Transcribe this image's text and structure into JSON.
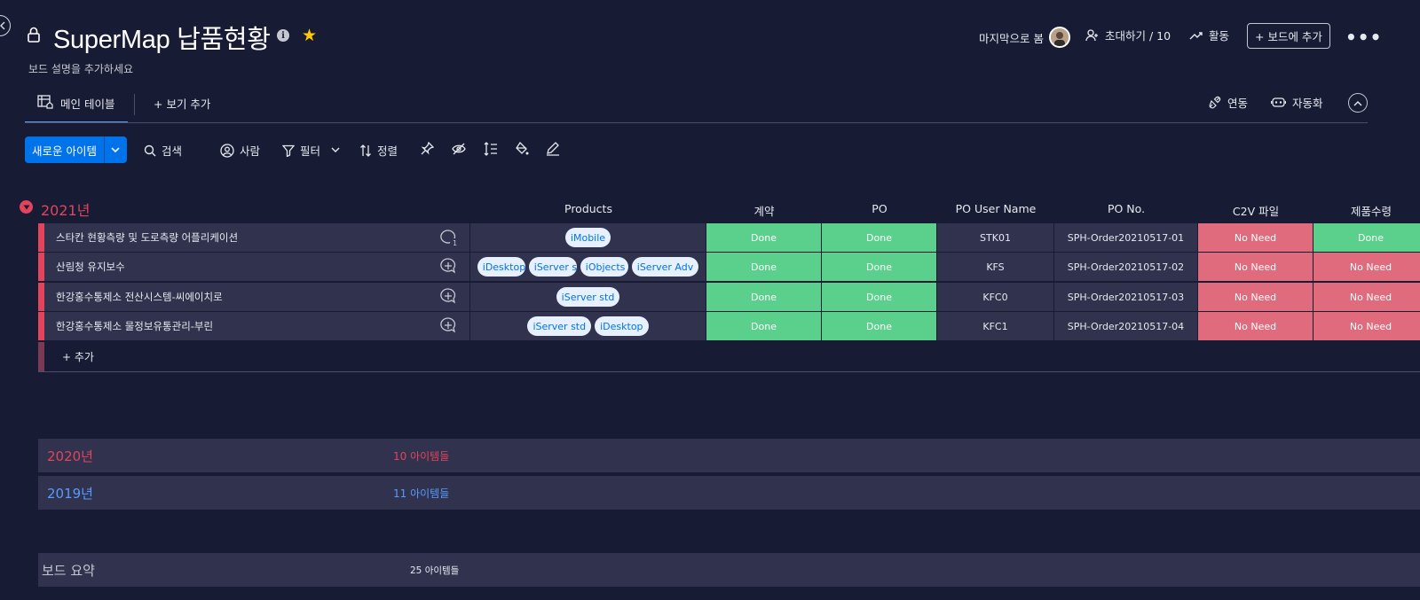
{
  "header": {
    "board_title": "SuperMap 납품현황",
    "board_description": "보드 설명을 추가하세요",
    "last_seen_label": "마지막으로 봄",
    "invite_label": "초대하기 / 10",
    "activity_label": "활동",
    "add_to_board_label": "+ 보드에 추가"
  },
  "tabs": {
    "main_table": "메인 테이블",
    "add_view": "+ 보기 추가",
    "integrate": "연동",
    "automate": "자동화"
  },
  "toolbar": {
    "new_item": "새로운 아이템",
    "search": "검색",
    "person": "사람",
    "filter": "필터",
    "sort": "정렬"
  },
  "columns": {
    "products": "Products",
    "contract": "계약",
    "po": "PO",
    "po_user": "PO User Name",
    "po_no": "PO No.",
    "c2v": "C2V 파일",
    "qty": "제품수령"
  },
  "group_2021": {
    "title": "2021년",
    "color": "#e2445c",
    "add_item": "+ 추가",
    "rows": [
      {
        "name": "스타칸 현황측량 및 도로측량 어플리케이션",
        "update_count": "1",
        "products": [
          "iMobile"
        ],
        "contract": "Done",
        "po": "Done",
        "po_user": "STK01",
        "po_no": "SPH-Order20210517-01",
        "c2v": "No Need",
        "qty": "Done"
      },
      {
        "name": "산림청 유지보수",
        "products": [
          "iDesktop",
          "iServer std",
          "iObjects",
          "iServer Adv"
        ],
        "contract": "Done",
        "po": "Done",
        "po_user": "KFS",
        "po_no": "SPH-Order20210517-02",
        "c2v": "No Need",
        "qty": "No Need"
      },
      {
        "name": "한강홍수통제소 전산시스템-씨에이치로",
        "products": [
          "iServer std"
        ],
        "contract": "Done",
        "po": "Done",
        "po_user": "KFC0",
        "po_no": "SPH-Order20210517-03",
        "c2v": "No Need",
        "qty": "No Need"
      },
      {
        "name": "한강홍수통제소 물정보유통관리-부린",
        "products": [
          "iServer std",
          "iDesktop"
        ],
        "contract": "Done",
        "po": "Done",
        "po_user": "KFC1",
        "po_no": "SPH-Order20210517-04",
        "c2v": "No Need",
        "qty": "No Need"
      }
    ]
  },
  "group_2020": {
    "title": "2020년",
    "count": "10 아이템들",
    "color": "#e2445c"
  },
  "group_2019": {
    "title": "2019년",
    "count": "11 아이템들",
    "color": "#579bfc"
  },
  "summary": {
    "title": "보드 요약",
    "count": "25 아이템들"
  },
  "colors": {
    "done": "#5bd08c",
    "no_need": "#df6b7c",
    "accent": "#0073ea"
  }
}
